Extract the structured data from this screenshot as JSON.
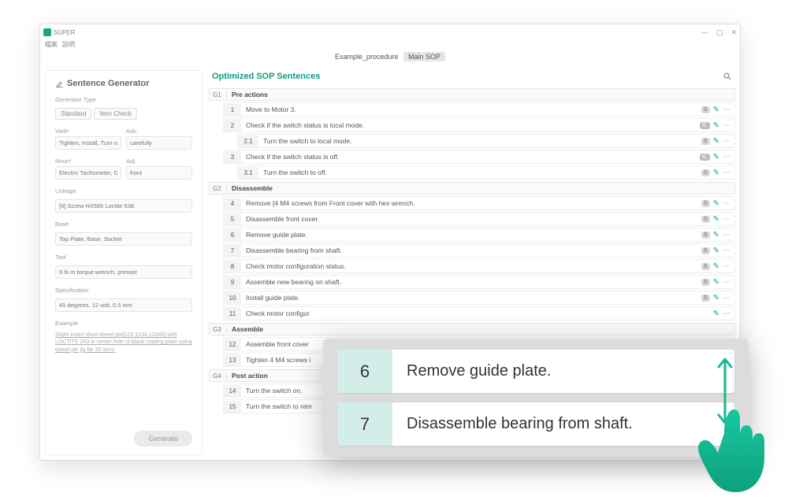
{
  "app": {
    "name": "SUPER",
    "menu0": "檔案",
    "menu1": "說明"
  },
  "winbtns": {
    "min": "—",
    "max": "▢",
    "close": "✕"
  },
  "breadcrumb": {
    "path": "Example_procedure",
    "chip": "Main SOP"
  },
  "left": {
    "title": "Sentence Generator",
    "gentype_label": "Generator Type",
    "seg_standard": "Standard",
    "seg_itemcheck": "Item Check",
    "verb_label": "Verb*",
    "verb_ph": "Tighten, Install, Turn on",
    "adv_label": "Adv.",
    "adv_ph": "carefully",
    "noun_label": "Noun*",
    "noun_ph": "Electric Tachometer, Detection LED",
    "adj_label": "Adj.",
    "adj_ph": "front",
    "linkage_label": "Linkage",
    "linkage_ph": "[6] Screw HX585 Loctite 638",
    "base_label": "Base",
    "base_ph": "Top Plate, Base, Socket",
    "tool_label": "Tool",
    "tool_ph": "9 N·m torque wrench, presser",
    "spec_label": "Specification",
    "spec_ph": "45 degrees, 12 volt, 0.5 mm",
    "example_label": "Example",
    "example_text": "Slight insert short dowel pin[123,1234,12345] with LOCTITE 243 in center hole of black coating plate using dowel pin jig for 30 secs.",
    "generate": "Generate"
  },
  "right": {
    "title": "Optimized SOP Sentences",
    "groups": [
      {
        "code": "G1",
        "title": "Pre actions",
        "items": [
          {
            "num": "1",
            "txt": "Move to Motor 3.",
            "badge": "S"
          },
          {
            "num": "2",
            "txt": "Check if the switch status is local mode.",
            "badge": "IC"
          },
          {
            "num": "2.1",
            "txt": "Turn the switch to local mode.",
            "badge": "S",
            "sub": true
          },
          {
            "num": "3",
            "txt": "Check if the switch status is off.",
            "badge": "IC"
          },
          {
            "num": "3.1",
            "txt": "Turn the switch to off.",
            "badge": "S",
            "sub": true
          }
        ]
      },
      {
        "code": "G2",
        "title": "Disassemble",
        "items": [
          {
            "num": "4",
            "txt": "Remove [4 M4 screws from Front cover with hex wrench.",
            "badge": "S"
          },
          {
            "num": "5",
            "txt": "Disassemble front cover.",
            "badge": "S"
          },
          {
            "num": "6",
            "txt": "Remove guide plate.",
            "badge": "S"
          },
          {
            "num": "7",
            "txt": "Disassemble bearing from shaft.",
            "badge": "S"
          },
          {
            "num": "8",
            "txt": "Check motor configuration status.",
            "badge": "S"
          },
          {
            "num": "9",
            "txt": "Assemble new bearing on shaft.",
            "badge": "S"
          },
          {
            "num": "10",
            "txt": "Install guide plate.",
            "badge": "S"
          },
          {
            "num": "11",
            "txt": "Check motor configur",
            "badge": ""
          }
        ]
      },
      {
        "code": "G3",
        "title": "Assemble",
        "items": [
          {
            "num": "12",
            "txt": "Assemble front cover",
            "badge": ""
          },
          {
            "num": "13",
            "txt": "Tighten 4 M4 screws i",
            "badge": ""
          }
        ]
      },
      {
        "code": "G4",
        "title": "Post action",
        "items": [
          {
            "num": "14",
            "txt": "Turn the switch on.",
            "badge": ""
          },
          {
            "num": "15",
            "txt": "Turn the switch to rem",
            "badge": ""
          }
        ]
      }
    ]
  },
  "callout": {
    "r0_num": "6",
    "r0_txt": "Remove guide plate.",
    "r1_num": "7",
    "r1_txt": "Disassemble bearing from shaft."
  }
}
